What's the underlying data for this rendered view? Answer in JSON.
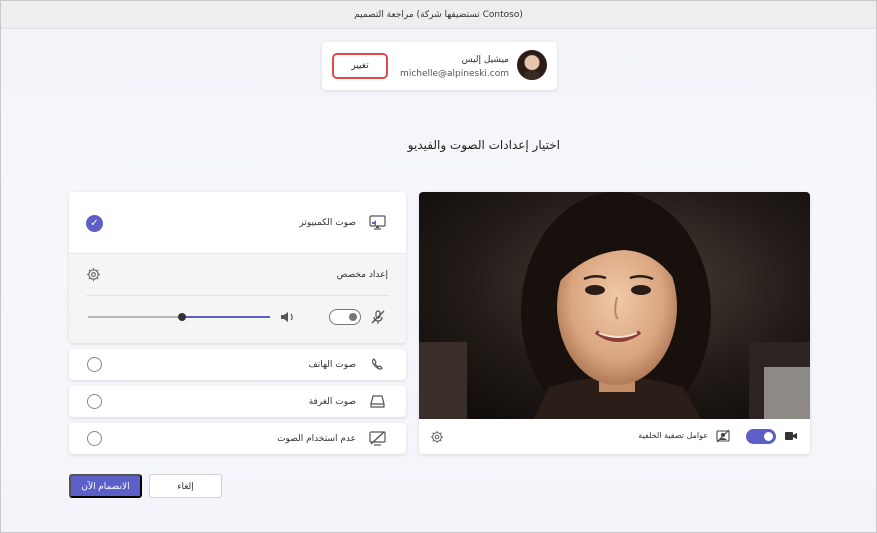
{
  "window": {
    "title": "مراجعة التصميم (تستضيفها شركة Contoso)"
  },
  "account": {
    "name": "ميشيل إليس",
    "email": "michelle@alpineski.com",
    "change_label": "تغيير"
  },
  "page": {
    "title": "اختيار إعدادات الصوت والفيديو"
  },
  "audio_options": {
    "computer_audio": "صوت الكمبيوتر",
    "custom_setup": "إعداد مخصص",
    "phone_audio": "صوت الهاتف",
    "room_audio": "صوت الغرفة",
    "no_audio": "عدم استخدام الصوت",
    "selected": "computer_audio",
    "mic_muted": false,
    "speaker_volume_percent": 48
  },
  "video": {
    "background_filters_label": "عوامل تصفية الخلفية",
    "camera_on": true
  },
  "actions": {
    "join_label": "الانضمام الآن",
    "cancel_label": "إلغاء"
  },
  "colors": {
    "accent": "#5b5fc7",
    "highlight_border": "#e24a4a"
  },
  "icons": [
    "settings-icon",
    "speaker-icon",
    "mic-off-icon",
    "computer-audio-icon",
    "phone-icon",
    "room-audio-icon",
    "no-audio-icon",
    "camera-icon",
    "background-filters-icon"
  ]
}
